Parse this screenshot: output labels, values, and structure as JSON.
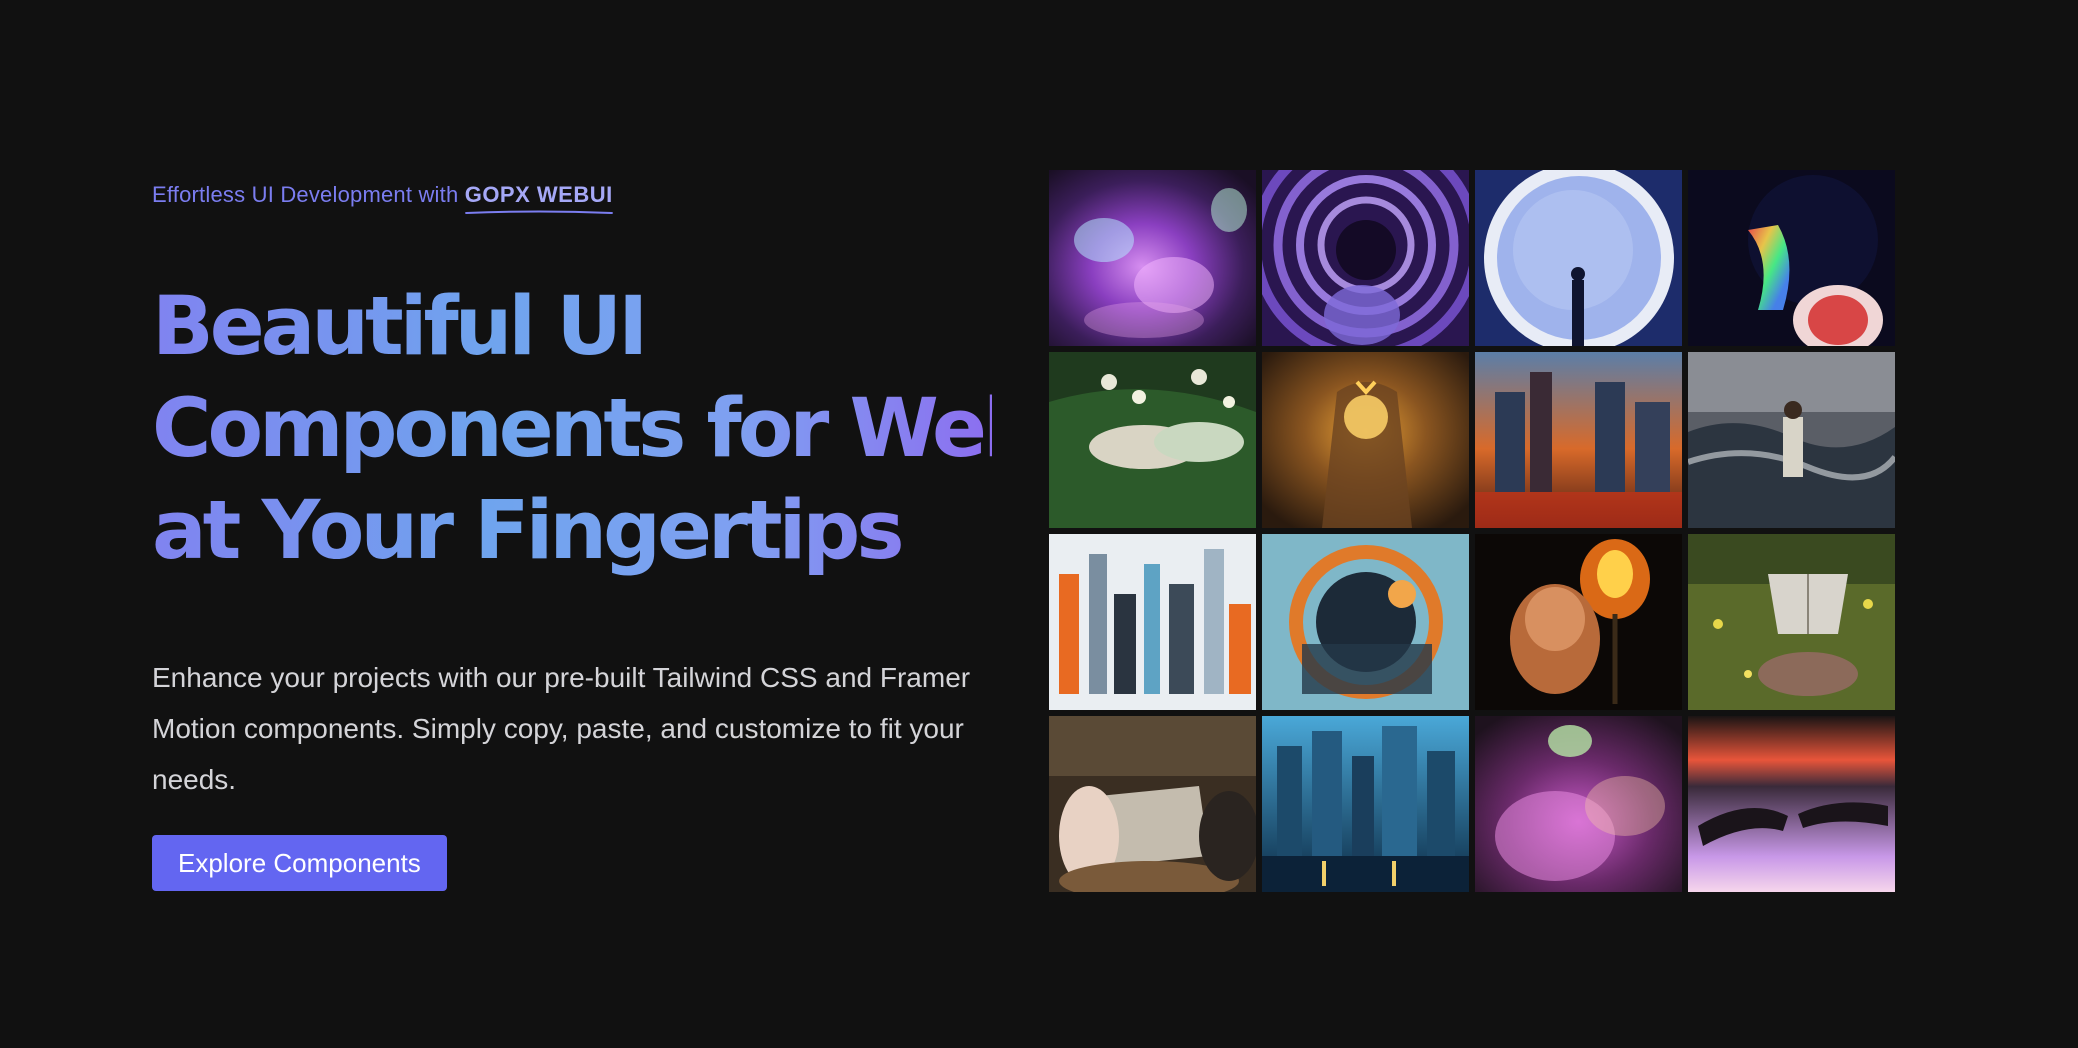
{
  "hero": {
    "eyebrow_prefix": "Effortless UI Development with",
    "eyebrow_brand": "GOPX WEBUI",
    "headline_lines": [
      "Beautiful UI",
      "Components for Web",
      "at Your Fingertips"
    ],
    "description": "Enhance your projects with our pre-built Tailwind CSS and Framer Motion components. Simply copy, paste, and customize to fit your needs.",
    "cta_label": "Explore Components"
  },
  "colors": {
    "background": "#111111",
    "accent": "#6366f1",
    "eyebrow": "#7b7df0",
    "gradient_start": "#8083f0",
    "gradient_end": "#8c6ef0"
  },
  "gallery": {
    "tiles": [
      "butterfly-glow-art",
      "purple-vortex-art",
      "moon-silhouette-art",
      "rainbow-light-art",
      "handshake-flowers-art",
      "golden-butterfly-art",
      "burning-city-art",
      "stormy-sea-art",
      "abstract-city-art",
      "circle-abstract-art",
      "fire-flower-art",
      "reading-field-art",
      "guitar-book-art",
      "rainy-skyline-art",
      "pink-butterfly-art",
      "touching-hands-art"
    ]
  }
}
